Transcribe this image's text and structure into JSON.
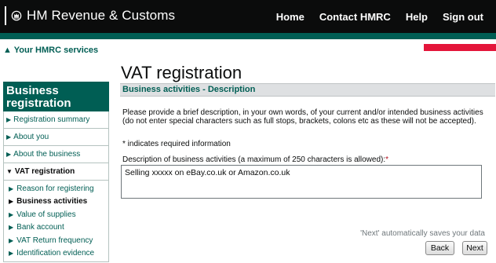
{
  "header": {
    "brand_name": "HM Revenue & Customs",
    "nav": [
      "Home",
      "Contact HMRC",
      "Help",
      "Sign out"
    ]
  },
  "back_link": "Your HMRC services",
  "page_title": "VAT registration",
  "sidebar": {
    "title": "Business registration",
    "items": [
      {
        "label": "Registration summary",
        "active": false
      },
      {
        "label": "About you",
        "active": false
      },
      {
        "label": "About the business",
        "active": false
      },
      {
        "label": "VAT registration",
        "active": true
      }
    ],
    "sub_items": [
      {
        "label": "Reason for registering",
        "current": false
      },
      {
        "label": "Business activities",
        "current": true
      },
      {
        "label": "Value of supplies",
        "current": false
      },
      {
        "label": "Bank account",
        "current": false
      },
      {
        "label": "VAT Return frequency",
        "current": false
      },
      {
        "label": "Identification evidence",
        "current": false
      }
    ]
  },
  "section": {
    "title": "Business activities - Description",
    "intro": "Please provide a brief description, in your own words, of your current and/or intended business activities (do not enter special characters such as full stops, brackets, colons etc as these will not be accepted).",
    "required_note": "* indicates required information",
    "field_label": "Description of business activities (a maximum of 250 characters is allowed):",
    "field_required_marker": "*",
    "field_value": "Selling xxxxx on eBay.co.uk or Amazon.co.uk"
  },
  "footer": {
    "save_note": "'Next' automatically saves your data",
    "back_label": "Back",
    "next_label": "Next"
  },
  "colors": {
    "header_bg": "#0b0c0c",
    "brand_teal": "#005e54",
    "alert_red": "#e4153a"
  },
  "icons": {
    "crest": "crown-crest-icon",
    "arrow_right": "triangle-right-icon",
    "arrow_down": "triangle-down-icon",
    "arrow_up": "triangle-up-icon"
  }
}
